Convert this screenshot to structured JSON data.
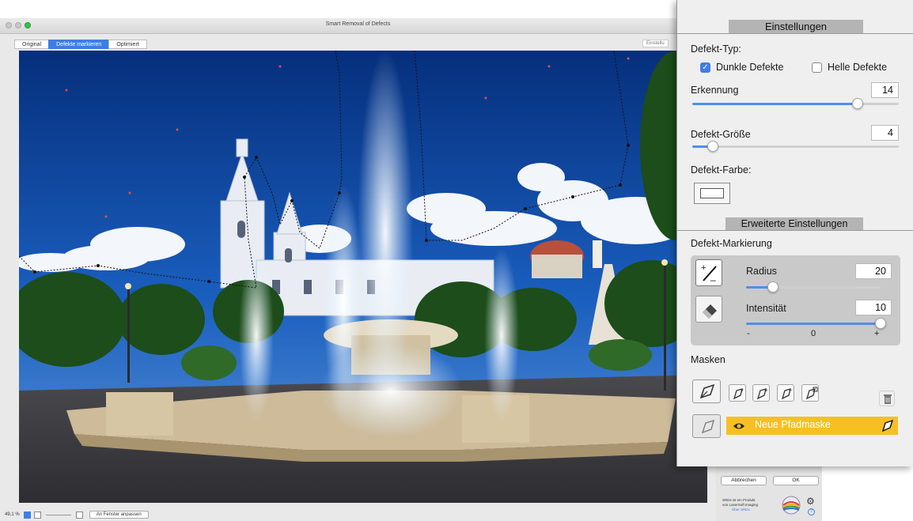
{
  "window": {
    "title": "Smart Removal of Defects",
    "view_tabs": [
      "Original",
      "Defekte markieren",
      "Optimiert"
    ],
    "active_view_tab": 1,
    "settings_stub": "Einstellu"
  },
  "statusbar": {
    "zoom": "49,1 %",
    "fit_button": "An Fenster anpassen"
  },
  "actions": {
    "cancel": "Abbrechen",
    "ok": "OK"
  },
  "branding": {
    "line1": "SRDx ist ein Produkt",
    "line2": "von LaserSoft Imaging",
    "link": "Über SRDx"
  },
  "panel": {
    "header": "Einstellungen",
    "defect_type_label": "Defekt-Typ:",
    "dark_defects": {
      "label": "Dunkle Defekte",
      "checked": true
    },
    "light_defects": {
      "label": "Helle Defekte",
      "checked": false
    },
    "detection": {
      "label": "Erkennung",
      "value": "14",
      "level": 0.8
    },
    "defect_size": {
      "label": "Defekt-Größe",
      "value": "4",
      "level": 0.1
    },
    "defect_color_label": "Defekt-Farbe:",
    "advanced_header": "Erweiterte Einstellungen",
    "marking_label": "Defekt-Markierung",
    "radius": {
      "label": "Radius",
      "value": "20",
      "level": 0.2
    },
    "intensity": {
      "label": "Intensität",
      "value": "10",
      "level": 1.0,
      "min_label": "-",
      "mid_label": "0",
      "max_label": "+"
    },
    "masks_label": "Masken",
    "mask_item": "Neue Pfadmaske"
  },
  "colors": {
    "accent": "#3d7ee6",
    "mask_highlight": "#f6c023",
    "panel_bg": "#efefef"
  },
  "icons": [
    "brush-plus-minus-icon",
    "eraser-icon",
    "pen-tool-icon",
    "mask-add-icon",
    "mask-plus-icon",
    "mask-minus-icon",
    "mask-intersect-icon",
    "trash-icon",
    "eye-icon",
    "gear-icon",
    "help-icon"
  ]
}
